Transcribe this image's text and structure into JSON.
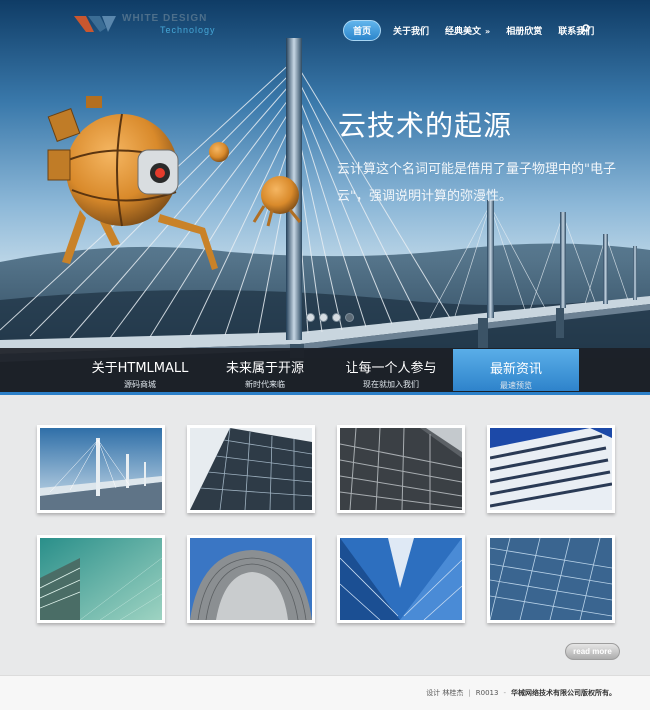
{
  "header": {
    "logo_name": "WHITE DESIGN",
    "logo_sub": "Technology"
  },
  "nav": {
    "items": [
      {
        "label": "首页",
        "active": true
      },
      {
        "label": "关于我们"
      },
      {
        "label": "经典美文",
        "has_arrow": true
      },
      {
        "label": "相册欣赏"
      },
      {
        "label": "联系我们"
      }
    ],
    "arrow": "»"
  },
  "slide": {
    "title": "云技术的起源",
    "text": "云计算这个名词可能是借用了量子物理中的\"电子云\"，强调说明计算的弥漫性。",
    "dots": 4,
    "active_dot": 3
  },
  "tabs": [
    {
      "title": "关于HTMLMALL",
      "sub": "源码商城"
    },
    {
      "title": "未来属于开源",
      "sub": "新时代来临"
    },
    {
      "title": "让每一个人参与",
      "sub": "现在就加入我们"
    },
    {
      "title": "最新资讯",
      "sub": "最速预览",
      "active": true
    }
  ],
  "gallery": {
    "items": [
      {
        "name": "bridge"
      },
      {
        "name": "glass-tower"
      },
      {
        "name": "grid-facade"
      },
      {
        "name": "striped-tower"
      },
      {
        "name": "green-glass"
      },
      {
        "name": "dome"
      },
      {
        "name": "blue-corner"
      },
      {
        "name": "blue-grid"
      }
    ],
    "readmore_label": "read more"
  },
  "footer": {
    "design_label": "设计",
    "designer": "林桂杰",
    "year": "R0013",
    "company": "华械网络技术有限公司版权所有。"
  },
  "colors": {
    "accent": "#2e83cb",
    "tabbar": "#1c2026",
    "page_bg": "#e8e9ea"
  }
}
